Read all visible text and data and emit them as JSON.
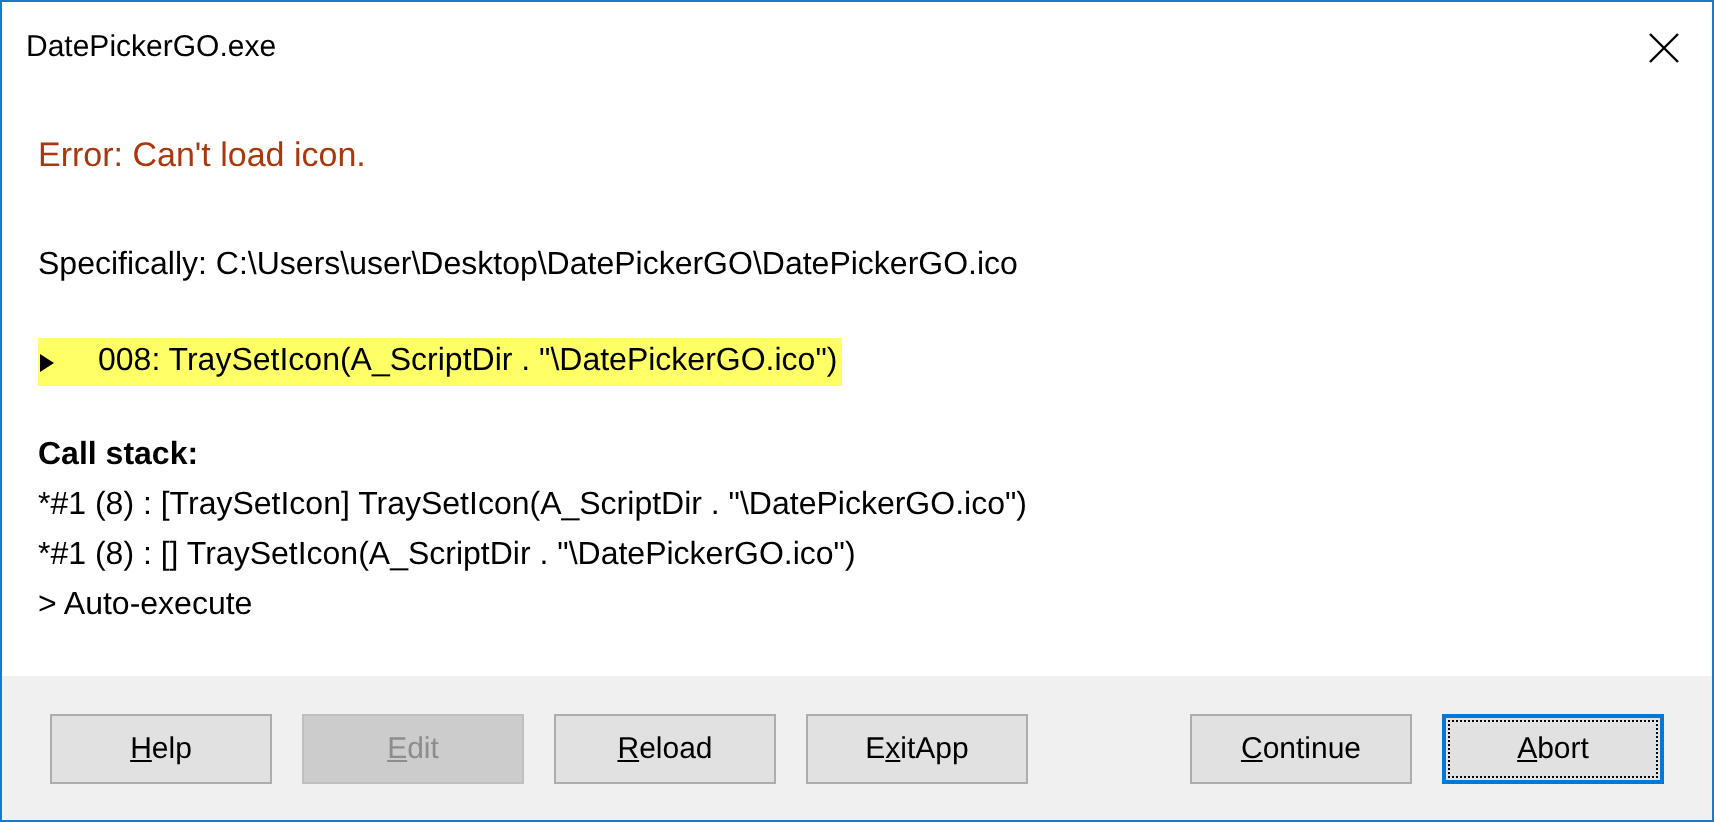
{
  "window": {
    "title": "DatePickerGO.exe"
  },
  "error": "Error: Can't load icon.",
  "specifically": "Specifically: C:\\Users\\user\\Desktop\\DatePickerGO\\DatePickerGO.ico",
  "current_line": {
    "text": "008: TraySetIcon(A_ScriptDir . \"\\DatePickerGO.ico\")",
    "highlighted": true
  },
  "call_stack": {
    "heading": "Call stack:",
    "lines": [
      "*#1 (8) : [TraySetIcon] TraySetIcon(A_ScriptDir . \"\\DatePickerGO.ico\")",
      "*#1 (8) : [] TraySetIcon(A_ScriptDir . \"\\DatePickerGO.ico\")",
      "> Auto-execute"
    ]
  },
  "left_buttons": [
    {
      "access_key": "H",
      "after": "elp",
      "disabled": false,
      "focused": false
    },
    {
      "access_key": "E",
      "after": "dit",
      "disabled": true,
      "focused": false
    },
    {
      "access_key": "R",
      "after": "eload",
      "disabled": false,
      "focused": false
    },
    {
      "before": "E",
      "access_key": "x",
      "after": "itApp",
      "disabled": false,
      "focused": false
    }
  ],
  "right_buttons": [
    {
      "access_key": "C",
      "after": "ontinue",
      "disabled": false,
      "focused": false
    },
    {
      "access_key": "A",
      "after": "bort",
      "disabled": false,
      "focused": true
    }
  ]
}
